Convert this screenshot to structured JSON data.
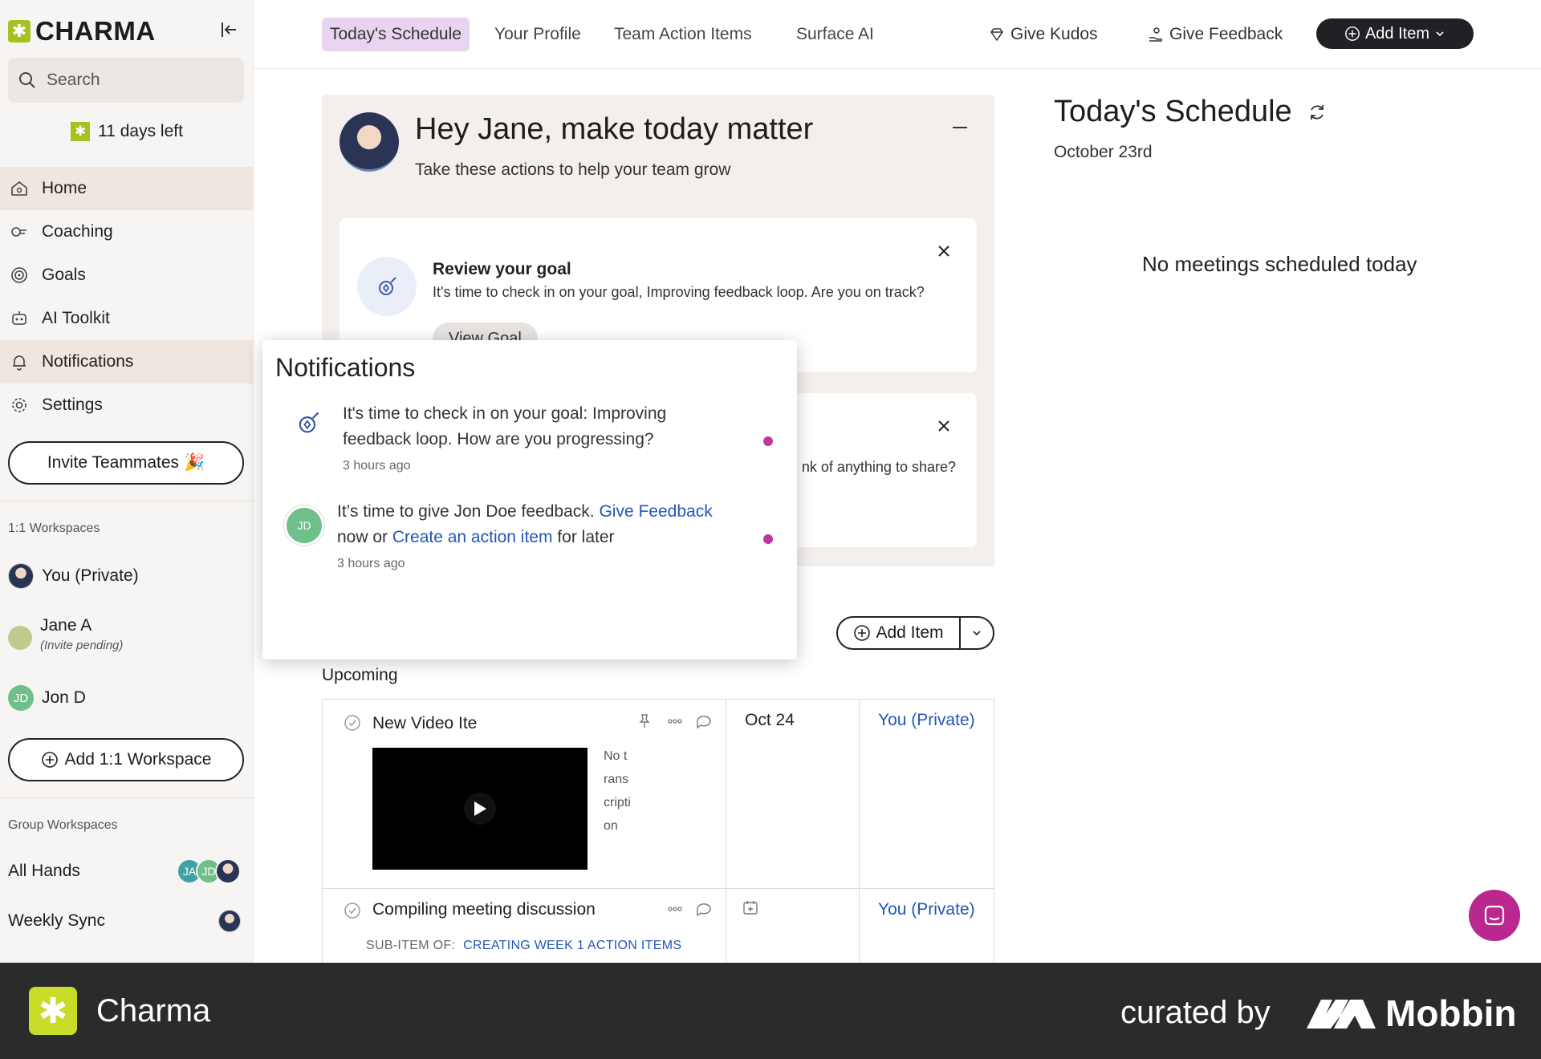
{
  "app": {
    "brand": "CHARMA",
    "trial": "11 days left"
  },
  "search": {
    "placeholder": "Search"
  },
  "sidebar": {
    "nav": [
      {
        "label": "Home",
        "icon": "home-icon"
      },
      {
        "label": "Coaching",
        "icon": "coaching-icon"
      },
      {
        "label": "Goals",
        "icon": "target-icon"
      },
      {
        "label": "AI Toolkit",
        "icon": "robot-icon"
      },
      {
        "label": "Notifications",
        "icon": "bell-icon"
      },
      {
        "label": "Settings",
        "icon": "gear-icon"
      }
    ],
    "invite_label": "Invite Teammates",
    "one_on_one_label": "1:1 Workspaces",
    "workspaces": [
      {
        "name": "You (Private)"
      },
      {
        "name": "Jane A",
        "note": "(Invite pending)"
      },
      {
        "name": "Jon D",
        "initials": "JD"
      }
    ],
    "add_workspace_label": "Add 1:1 Workspace",
    "group_label": "Group Workspaces",
    "groups": [
      {
        "name": "All Hands",
        "avatars": [
          "JA",
          "JD"
        ]
      },
      {
        "name": "Weekly Sync"
      }
    ]
  },
  "topnav": {
    "tabs": [
      "Today's Schedule",
      "Your Profile",
      "Team Action Items",
      "Surface AI"
    ],
    "kudos": "Give Kudos",
    "feedback": "Give Feedback",
    "add_item": "Add Item"
  },
  "hero": {
    "title": "Hey Jane, make today matter",
    "subtitle": "Take these actions to help your team grow",
    "card1": {
      "title": "Review your goal",
      "desc": "It's time to check in on your goal, Improving feedback loop. Are you on track?",
      "button": "View Goal"
    },
    "card2": {
      "desc": "nk of anything to share?"
    }
  },
  "actions": {
    "add_item": "Add Item",
    "upcoming": "Upcoming"
  },
  "items": [
    {
      "title": "New Video Ite",
      "transcript": "No transcription",
      "date": "Oct 24",
      "owner": "You (Private)"
    },
    {
      "title": "Compiling meeting discussion",
      "sub_label": "SUB-ITEM OF:",
      "sub_link": "CREATING WEEK 1 ACTION ITEMS",
      "owner": "You (Private)"
    }
  ],
  "schedule": {
    "title": "Today's Schedule",
    "date": "October 23rd",
    "empty": "No meetings scheduled today"
  },
  "notifications": {
    "title": "Notifications",
    "n1": {
      "text": "It's time to check in on your goal: Improving feedback loop. How are you progressing?",
      "time": "3 hours ago"
    },
    "n2": {
      "pre": "It’s time to give Jon Doe feedback.",
      "link1": "Give Feedback",
      "mid1": "now or",
      "link2": "Create an action item",
      "mid2": "for later",
      "time": "3 hours ago",
      "initials": "JD"
    }
  },
  "footer": {
    "app": "Charma",
    "curated": "curated by",
    "brand": "Mobbin"
  },
  "colors": {
    "accent": "#a8c021",
    "active_tab": "#e8d4f0",
    "link": "#2356b8",
    "dot": "#c0359f",
    "fab": "#b8288e"
  }
}
